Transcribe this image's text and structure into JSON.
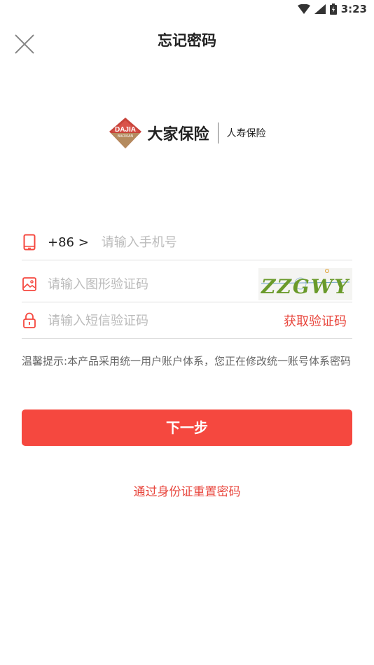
{
  "status_bar": {
    "time": "3:23"
  },
  "header": {
    "title": "忘记密码"
  },
  "logo": {
    "main_text": "大家保险",
    "sub_text": "人寿保险",
    "badge_text": "DAJIA",
    "badge_subtext": "BAOXIAN"
  },
  "phone": {
    "country_code": "+86 >",
    "placeholder": "请输入手机号"
  },
  "image_captcha": {
    "placeholder": "请输入图形验证码",
    "captcha_text": "ZZGWY"
  },
  "sms_code": {
    "placeholder": "请输入短信验证码",
    "get_code_label": "获取验证码"
  },
  "tip": "温馨提示:本产品采用统一用户账户体系，您正在修改统一账号体系密码",
  "next_button_label": "下一步",
  "id_reset_link": "通过身份证重置密码",
  "colors": {
    "accent": "#f5483f",
    "link": "#e8463d"
  }
}
